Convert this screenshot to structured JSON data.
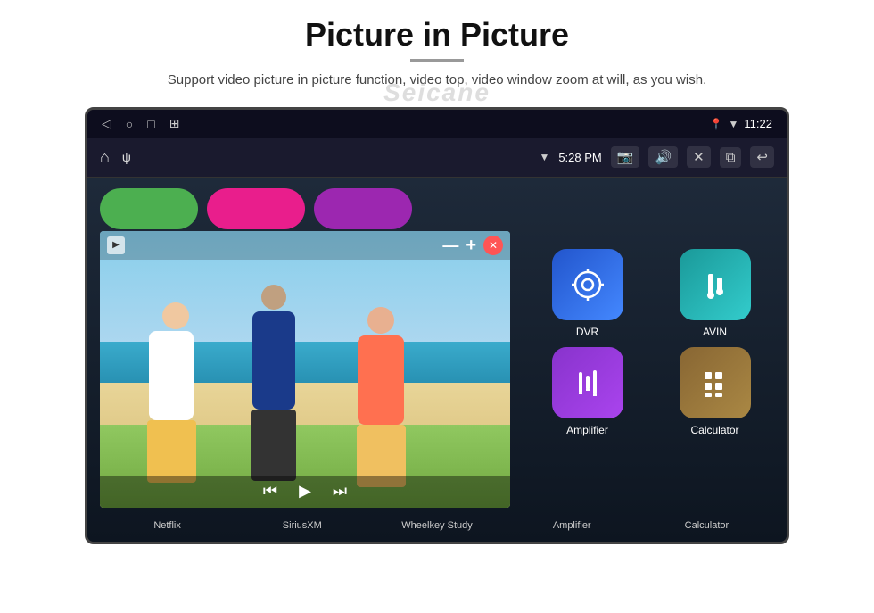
{
  "page": {
    "title": "Picture in Picture",
    "watermark": "Seicane",
    "description": "Support video picture in picture function, video top, video window zoom at will, as you wish."
  },
  "statusBar": {
    "time": "11:22",
    "navBack": "◁",
    "navHome": "○",
    "navRecent": "□",
    "navMenu": "⊞"
  },
  "toolbar": {
    "home": "⌂",
    "usb": "ψ",
    "time": "5:28 PM",
    "back": "↩"
  },
  "pip": {
    "minimizeLabel": "—",
    "maximizeLabel": "+",
    "closeLabel": "✕",
    "prevLabel": "⏮",
    "playLabel": "▶",
    "nextLabel": "⏭"
  },
  "apps": {
    "topRow": [
      {
        "label": "Netflix",
        "color": "pill-green"
      },
      {
        "label": "SiriusXM",
        "color": "pill-pink"
      },
      {
        "label": "Wheelkey Study",
        "color": "pill-purple"
      }
    ],
    "rightGrid": [
      {
        "id": "dvr",
        "label": "DVR",
        "color": "icon-blue",
        "icon": "📡"
      },
      {
        "id": "avin",
        "label": "AVIN",
        "color": "icon-teal",
        "icon": "🔌"
      },
      {
        "id": "amplifier",
        "label": "Amplifier",
        "color": "icon-purple",
        "icon": "🎚"
      },
      {
        "id": "calculator",
        "label": "Calculator",
        "color": "icon-brown",
        "icon": "🧮"
      }
    ]
  },
  "bottomLabels": [
    "Netflix",
    "SiriusXM",
    "Wheelkey Study",
    "Amplifier",
    "Calculator"
  ]
}
